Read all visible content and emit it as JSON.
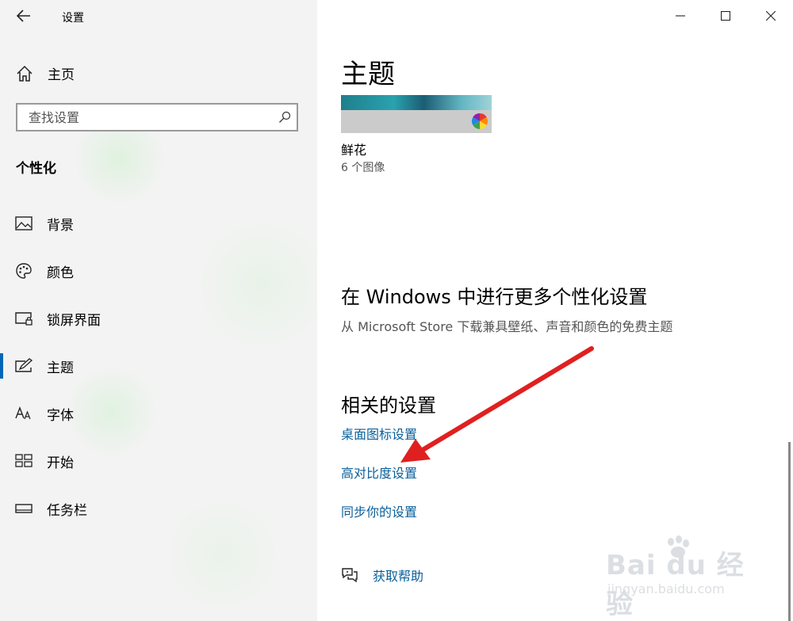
{
  "window": {
    "title": "设置",
    "back_icon": "back-arrow-icon"
  },
  "sidebar": {
    "home_label": "主页",
    "search_placeholder": "查找设置",
    "section_title": "个性化",
    "items": [
      {
        "label": "背景",
        "icon": "image-icon",
        "selected": false
      },
      {
        "label": "颜色",
        "icon": "palette-icon",
        "selected": false
      },
      {
        "label": "锁屏界面",
        "icon": "lock-screen-icon",
        "selected": false
      },
      {
        "label": "主题",
        "icon": "theme-icon",
        "selected": true
      },
      {
        "label": "字体",
        "icon": "font-icon",
        "selected": false
      },
      {
        "label": "开始",
        "icon": "start-icon",
        "selected": false
      },
      {
        "label": "任务栏",
        "icon": "taskbar-icon",
        "selected": false
      }
    ]
  },
  "main": {
    "title": "主题",
    "theme": {
      "name": "鲜花",
      "count": "6 个图像"
    },
    "more_section": {
      "title": "在 Windows 中进行更多个性化设置",
      "subtitle": "从 Microsoft Store 下载兼具壁纸、声音和颜色的免费主题"
    },
    "related": {
      "title": "相关的设置",
      "links": [
        "桌面图标设置",
        "高对比度设置",
        "同步你的设置"
      ]
    },
    "help_label": "获取帮助"
  },
  "watermark": {
    "brand": "Bai du 经验",
    "url": "jingyan.baidu.com"
  },
  "colors": {
    "accent": "#0067b8",
    "link": "#0a5f9a",
    "sidebar_bg": "#f3f3f3",
    "arrow": "#e02020"
  }
}
